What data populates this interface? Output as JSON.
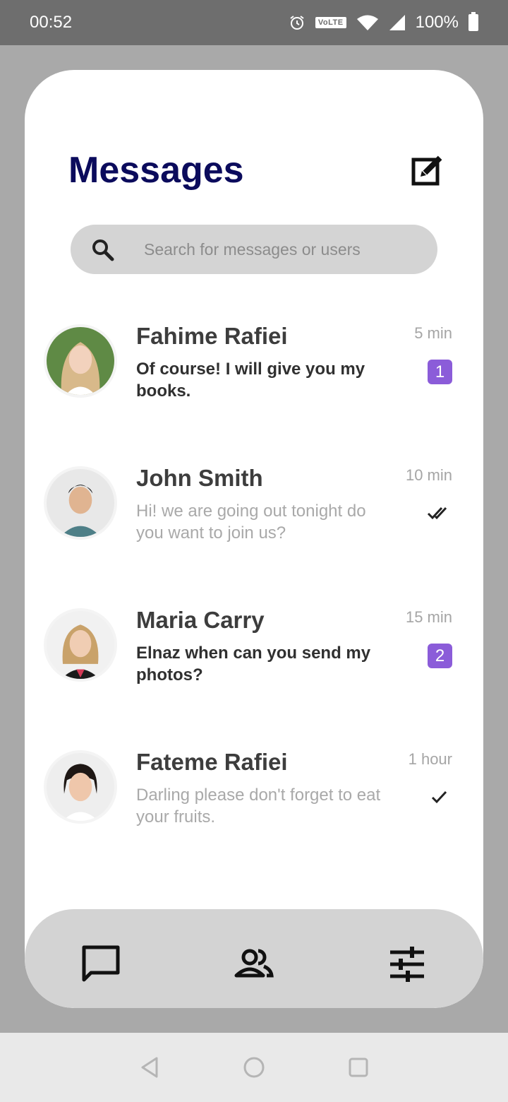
{
  "status_bar": {
    "time": "00:52",
    "volte_label": "VoLTE",
    "battery": "100%",
    "icons": [
      "alarm-icon",
      "volte-icon",
      "wifi-icon",
      "signal-icon",
      "battery-icon"
    ]
  },
  "header": {
    "title": "Messages",
    "compose_icon": "compose-icon"
  },
  "search": {
    "placeholder": "Search for messages or users",
    "icon": "search-icon"
  },
  "conversations": [
    {
      "name": "Fahime Rafiei",
      "preview": "Of course! I will give you my books.",
      "time": "5 min",
      "unread_count": "1",
      "status": "unread"
    },
    {
      "name": "John Smith",
      "preview": "Hi! we are going out tonight do you want to join us?",
      "time": "10 min",
      "status": "read"
    },
    {
      "name": "Maria Carry",
      "preview": "Elnaz when can you send my photos?",
      "time": "15 min",
      "unread_count": "2",
      "status": "unread"
    },
    {
      "name": "Fateme Rafiei",
      "preview": "Darling please don't forget to eat your fruits.",
      "time": "1 hour",
      "status": "sent"
    }
  ],
  "bottom_nav": {
    "items": [
      "chat-icon",
      "contacts-icon",
      "settings-sliders-icon"
    ]
  },
  "system_nav": {
    "items": [
      "back-icon",
      "home-icon",
      "recents-icon"
    ]
  },
  "colors": {
    "title": "#0b0b5c",
    "badge": "#8b5cd9",
    "card": "#ffffff",
    "nav_bar": "#d3d3d3",
    "backdrop": "#a9a9a9"
  }
}
